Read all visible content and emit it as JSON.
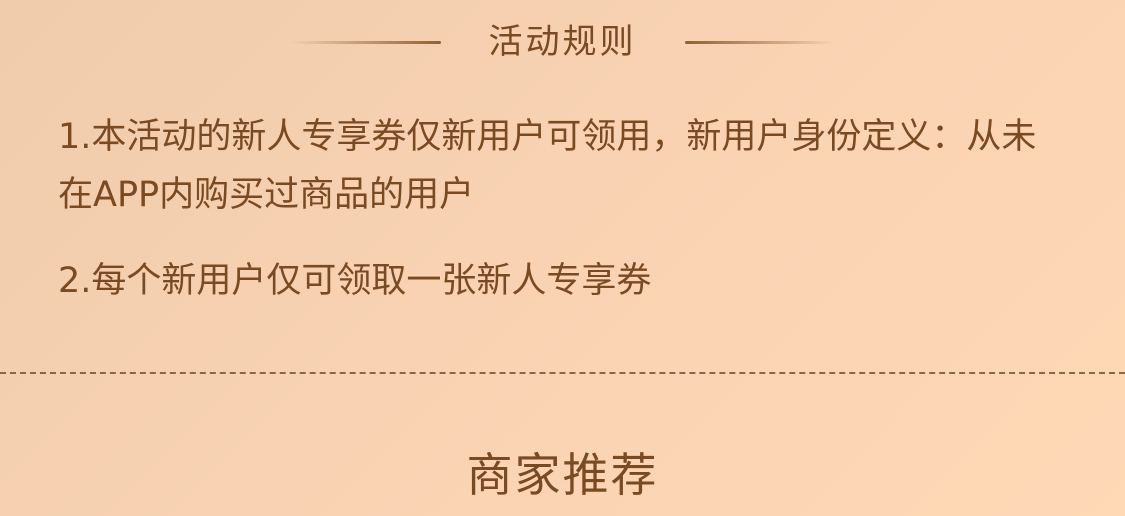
{
  "rules": {
    "title": "活动规则",
    "items": [
      {
        "text": "1.本活动的新人专享券仅新用户可领用，新用户身份定义：从未在APP内购买过商品的用户"
      },
      {
        "text": "2.每个新用户仅可领取一张新人专享券"
      }
    ]
  },
  "merchant_section": {
    "title": "商家推荐"
  },
  "colors": {
    "background": "#f8d2b2",
    "text": "#7a4a22",
    "divider": "#8a6549"
  }
}
